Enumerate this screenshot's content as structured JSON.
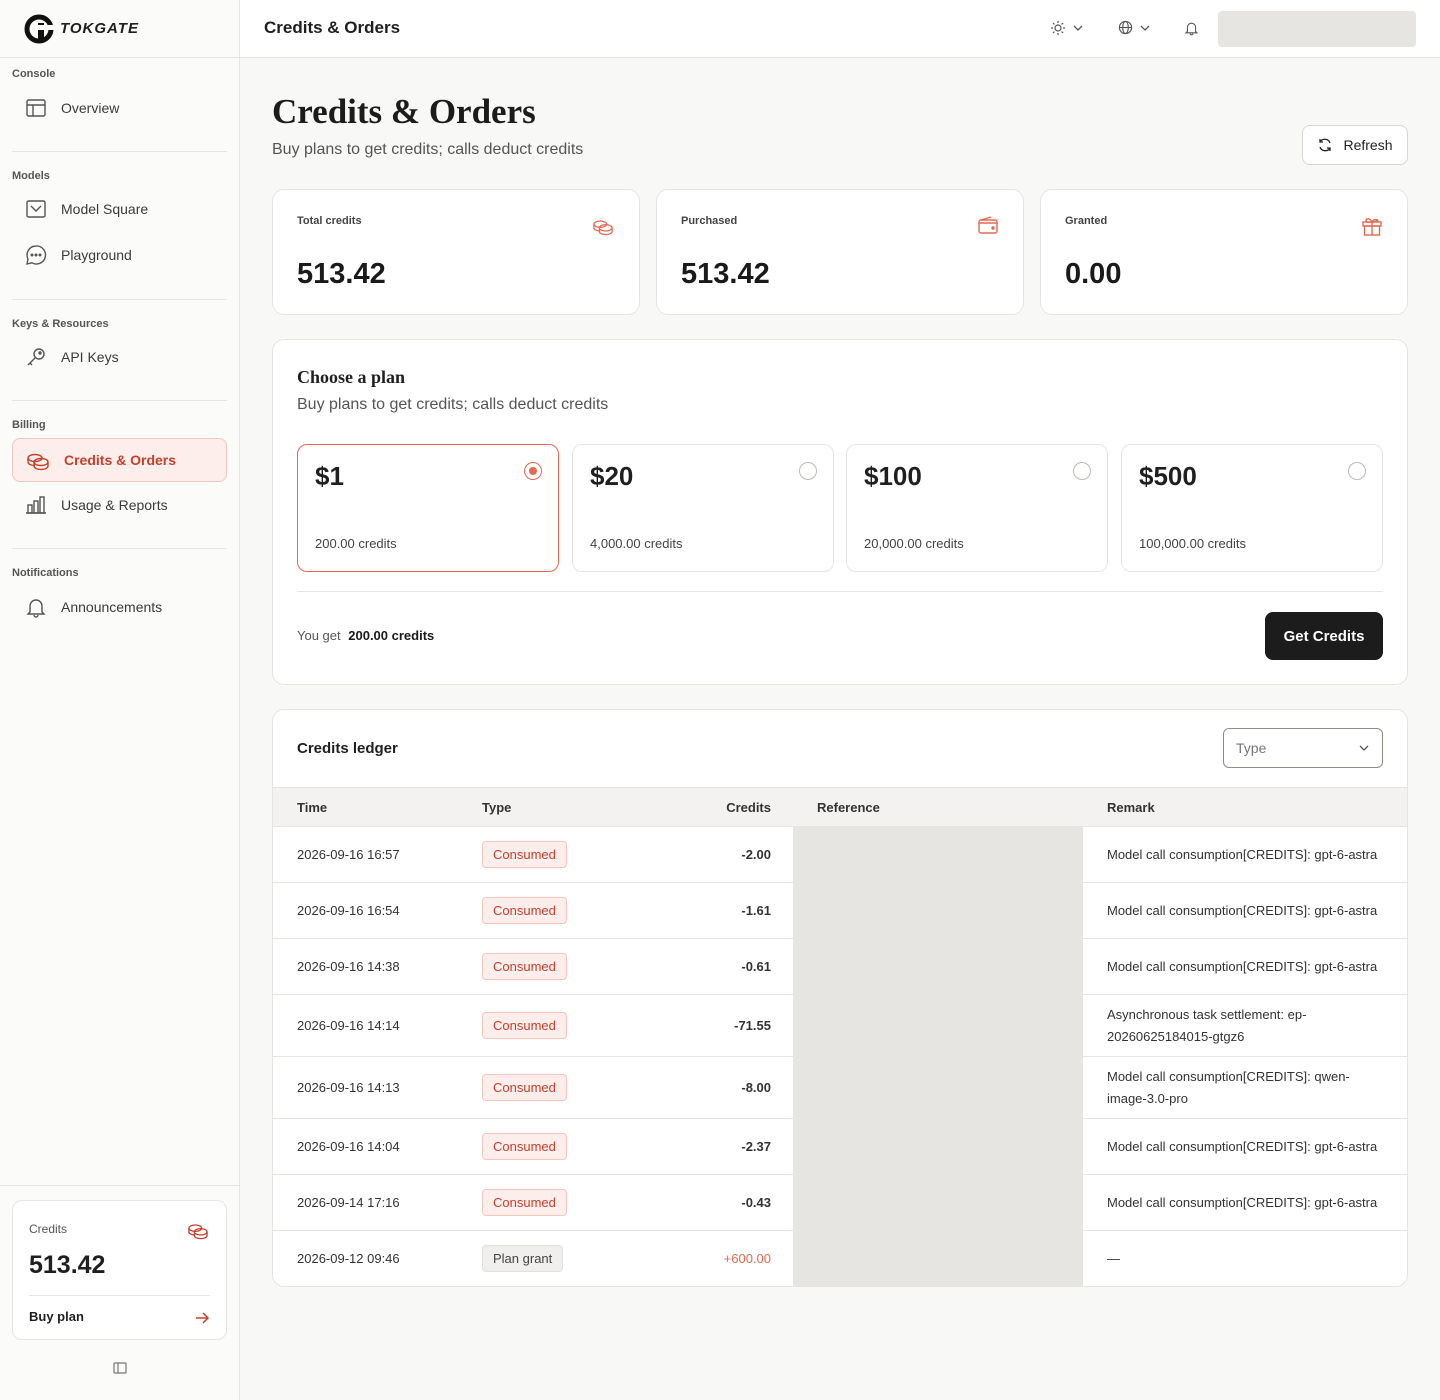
{
  "brand": {
    "name": "TOKGATE"
  },
  "sidebar": {
    "sections": [
      {
        "label": "Console",
        "items": [
          {
            "label": "Overview",
            "icon": "layout-icon"
          }
        ]
      },
      {
        "label": "Models",
        "items": [
          {
            "label": "Model Square",
            "icon": "inbox-icon"
          },
          {
            "label": "Playground",
            "icon": "chat-icon"
          }
        ]
      },
      {
        "label": "Keys & Resources",
        "items": [
          {
            "label": "API Keys",
            "icon": "key-icon"
          }
        ]
      },
      {
        "label": "Billing",
        "items": [
          {
            "label": "Credits & Orders",
            "icon": "coins-icon",
            "active": true
          },
          {
            "label": "Usage & Reports",
            "icon": "bar-chart-icon"
          }
        ]
      },
      {
        "label": "Notifications",
        "items": [
          {
            "label": "Announcements",
            "icon": "bell-icon"
          }
        ]
      }
    ],
    "credits_card": {
      "label": "Credits",
      "value": "513.42",
      "action": "Buy plan"
    }
  },
  "topbar": {
    "title": "Credits & Orders"
  },
  "page": {
    "title": "Credits & Orders",
    "subtitle": "Buy plans to get credits; calls deduct credits",
    "refresh_label": "Refresh"
  },
  "stats": [
    {
      "label": "Total credits",
      "value": "513.42",
      "icon": "coins-icon"
    },
    {
      "label": "Purchased",
      "value": "513.42",
      "icon": "wallet-icon"
    },
    {
      "label": "Granted",
      "value": "0.00",
      "icon": "gift-icon"
    }
  ],
  "plans": {
    "title": "Choose a plan",
    "subtitle": "Buy plans to get credits; calls deduct credits",
    "options": [
      {
        "price": "$1",
        "credits": "200.00 credits",
        "selected": true
      },
      {
        "price": "$20",
        "credits": "4,000.00 credits",
        "selected": false
      },
      {
        "price": "$100",
        "credits": "20,000.00 credits",
        "selected": false
      },
      {
        "price": "$500",
        "credits": "100,000.00 credits",
        "selected": false
      }
    ],
    "you_get_label": "You get",
    "you_get_value": "200.00 credits",
    "cta": "Get Credits"
  },
  "ledger": {
    "title": "Credits ledger",
    "type_placeholder": "Type",
    "columns": [
      "Time",
      "Type",
      "Credits",
      "Reference",
      "Remark"
    ],
    "rows": [
      {
        "time": "2026-09-16 16:57",
        "type": "Consumed",
        "credits": "-2.00",
        "remark": "Model call consumption[CREDITS]: gpt-6-astra"
      },
      {
        "time": "2026-09-16 16:54",
        "type": "Consumed",
        "credits": "-1.61",
        "remark": "Model call consumption[CREDITS]: gpt-6-astra"
      },
      {
        "time": "2026-09-16 14:38",
        "type": "Consumed",
        "credits": "-0.61",
        "remark": "Model call consumption[CREDITS]: gpt-6-astra"
      },
      {
        "time": "2026-09-16 14:14",
        "type": "Consumed",
        "credits": "-71.55",
        "remark": "Asynchronous task settlement: ep-20260625184015-gtgz6"
      },
      {
        "time": "2026-09-16 14:13",
        "type": "Consumed",
        "credits": "-8.00",
        "remark": "Model call consumption[CREDITS]: qwen-image-3.0-pro"
      },
      {
        "time": "2026-09-16 14:04",
        "type": "Consumed",
        "credits": "-2.37",
        "remark": "Model call consumption[CREDITS]: gpt-6-astra"
      },
      {
        "time": "2026-09-14 17:16",
        "type": "Consumed",
        "credits": "-0.43",
        "remark": "Model call consumption[CREDITS]: gpt-6-astra"
      },
      {
        "time": "2026-09-12 09:46",
        "type": "Plan grant",
        "credits": "+600.00",
        "remark": "—"
      }
    ]
  },
  "colors": {
    "accent": "#e06a52",
    "accent_dark": "#c2412d",
    "accent_bg": "#fdeeeb"
  }
}
